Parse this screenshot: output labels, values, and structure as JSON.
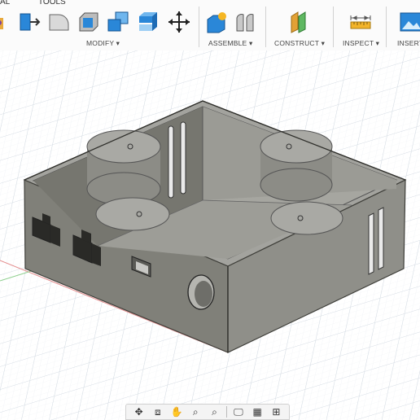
{
  "toolbar": {
    "tabs": [
      "AL",
      "TOOLS"
    ],
    "groups": {
      "modify": "MODIFY ▾",
      "assemble": "ASSEMBLE ▾",
      "construct": "CONSTRUCT ▾",
      "inspect": "INSPECT ▾",
      "insert": "INSERT"
    },
    "tools": [
      "press-pull-icon",
      "fillet-icon",
      "shell-icon",
      "combine-icon",
      "split-body-icon",
      "move-icon",
      "new-component-icon",
      "joint-icon",
      "offset-plane-icon",
      "measure-icon",
      "insert-image-icon"
    ]
  },
  "navbar": {
    "items": [
      "orbit-icon",
      "look-at-icon",
      "pan-icon",
      "zoom-icon",
      "fit-icon",
      "display-settings-icon",
      "grid-settings-icon",
      "viewports-icon"
    ]
  },
  "colors": {
    "accent": "#1c7ad3",
    "model": "#8a8a84"
  }
}
